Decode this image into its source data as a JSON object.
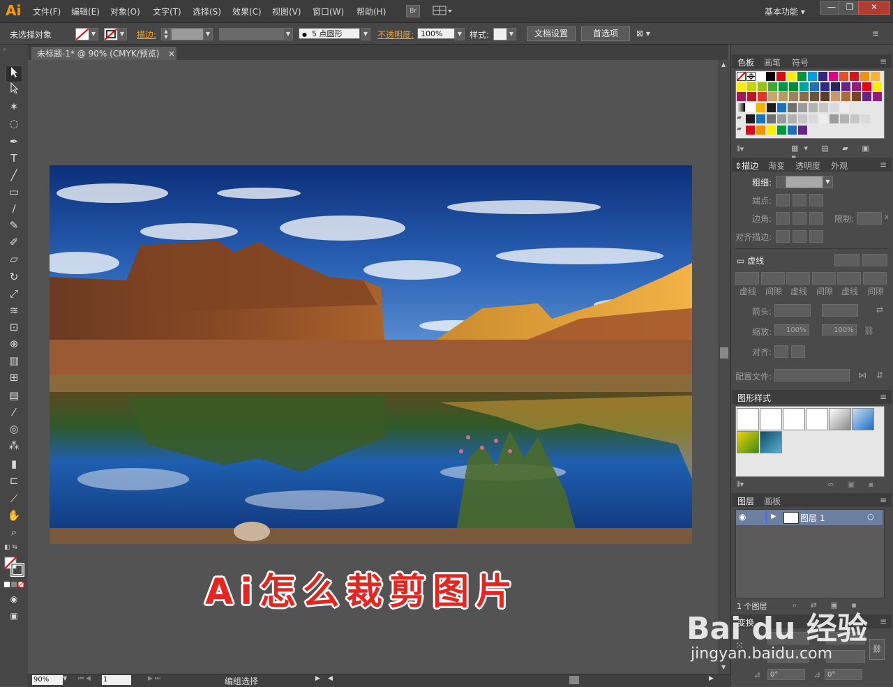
{
  "app": {
    "logo": "Ai"
  },
  "menu": [
    "文件(F)",
    "编辑(E)",
    "对象(O)",
    "文字(T)",
    "选择(S)",
    "效果(C)",
    "视图(V)",
    "窗口(W)",
    "帮助(H)"
  ],
  "bridge_label": "Br",
  "workspace": "基本功能",
  "window_buttons": {
    "minimize": "—",
    "restore": "❐",
    "close": "✕"
  },
  "control": {
    "selection": "未选择对象",
    "stroke_label": "描边:",
    "brush_dot": "●",
    "brush_size": "5",
    "brush_shape": "点圆形",
    "opacity_label": "不透明度:",
    "opacity_value": "100%",
    "style_label": "样式:",
    "doc_setup": "文档设置",
    "preferences": "首选项"
  },
  "document": {
    "tab_title": "未标题-1* @ 90% (CMYK/预览)",
    "close": "×"
  },
  "caption": "Ai怎么裁剪图片",
  "status": {
    "zoom": "90%",
    "page": "1",
    "mode": "编组选择"
  },
  "panels": {
    "swatch_tabs": [
      "色板",
      "画笔",
      "符号"
    ],
    "stroke_tabs": [
      "描边",
      "渐变",
      "透明度",
      "外观"
    ],
    "stroke": {
      "weight_label": "粗细:",
      "cap_label": "端点:",
      "corner_label": "边角:",
      "limit_label": "限制:",
      "limit_unit": "x",
      "align_label": "对齐描边:",
      "dashed_label": "虚线",
      "dash_cols": [
        "虚线",
        "间隙",
        "虚线",
        "间隙",
        "虚线",
        "间隙"
      ],
      "arrow_label": "箭头:",
      "scale_label": "缩放:",
      "scale_a": "100%",
      "scale_b": "100%",
      "arrow_align_label": "对齐:",
      "profile_label": "配置文件:"
    },
    "graphic_styles_tab": "图形样式",
    "layers_tabs": [
      "图层",
      "画板"
    ],
    "layer_name": "图层 1",
    "layer_count": "1 个图层",
    "transform_tab": "变换",
    "rotate_value": "0°",
    "shear_value": "0°",
    "colors": {
      "swatch_row1": [
        "#ffffff",
        "#000000",
        "#e30613",
        "#ffed00",
        "#009640",
        "#009fe3",
        "#312783",
        "#e6007e",
        "#e94e1b",
        "#d4161a",
        "#f39200",
        "#f9b233"
      ],
      "swatch_row2": [
        "#fcea10",
        "#c8d400",
        "#95c11f",
        "#3aaa35",
        "#00963f",
        "#008d36",
        "#00a19a",
        "#1d71b8",
        "#2d2e83",
        "#29235c",
        "#662483",
        "#951b81"
      ],
      "swatch_row3": [
        "#a2195b",
        "#be1622",
        "#e6332a",
        "#c6a969",
        "#b49a63",
        "#9d8258",
        "#866c4a",
        "#705239",
        "#5b3d2a",
        "#c99a63",
        "#a86b3c",
        "#7a4420"
      ],
      "swatch_row4": [
        "#ffffff",
        "#f4b400",
        "#1d1d1b",
        "#1d71b8",
        "#6f6f6e",
        "#9c9b9b",
        "#b2b2b2",
        "#c6c6c6",
        "#dadada",
        "#ededed"
      ],
      "swatch_row5": [
        "#e30613",
        "#f39200",
        "#ffed00",
        "#009640",
        "#1d71b8",
        "#662483"
      ]
    }
  },
  "watermark": {
    "brand": "Bai du 经验",
    "url": "jingyan.baidu.com"
  }
}
